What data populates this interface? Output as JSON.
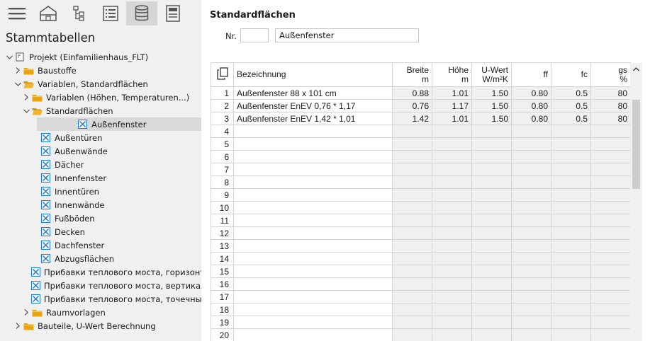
{
  "toolbar": {
    "buttons": [
      {
        "name": "menu-icon"
      },
      {
        "name": "building-icon"
      },
      {
        "name": "tree-structure-icon"
      },
      {
        "name": "list-icon"
      },
      {
        "name": "database-icon",
        "active": true
      },
      {
        "name": "calculator-icon"
      }
    ]
  },
  "left": {
    "title": "Stammtabellen",
    "tree": [
      {
        "label": "Projekt (Einfamilienhaus_FLT)",
        "level": 0,
        "expanded": true,
        "icon": "project-icon"
      },
      {
        "label": "Baustoffe",
        "level": 1,
        "expanded": false,
        "icon": "folder-icon"
      },
      {
        "label": "Variablen, Standardflächen",
        "level": 1,
        "expanded": true,
        "icon": "folder-open-icon"
      },
      {
        "label": "Variablen (Höhen, Temperaturen...)",
        "level": 2,
        "expanded": false,
        "icon": "folder-icon"
      },
      {
        "label": "Standardflächen",
        "level": 2,
        "expanded": true,
        "icon": "folder-open-icon"
      },
      {
        "label": "Außenfenster",
        "level": 3,
        "icon": "table-icon",
        "selected": true
      },
      {
        "label": "Außentüren",
        "level": 3,
        "icon": "table-icon"
      },
      {
        "label": "Außenwände",
        "level": 3,
        "icon": "table-icon"
      },
      {
        "label": "Dächer",
        "level": 3,
        "icon": "table-icon"
      },
      {
        "label": "Innenfenster",
        "level": 3,
        "icon": "table-icon"
      },
      {
        "label": "Innentüren",
        "level": 3,
        "icon": "table-icon"
      },
      {
        "label": "Innenwände",
        "level": 3,
        "icon": "table-icon"
      },
      {
        "label": "Fußböden",
        "level": 3,
        "icon": "table-icon"
      },
      {
        "label": "Decken",
        "level": 3,
        "icon": "table-icon"
      },
      {
        "label": "Dachfenster",
        "level": 3,
        "icon": "table-icon"
      },
      {
        "label": "Abzugsflächen",
        "level": 3,
        "icon": "table-icon"
      },
      {
        "label": "Прибавки теплового моста, горизонта",
        "level": 3,
        "icon": "table-icon"
      },
      {
        "label": "Прибавки теплового моста, вертикаль",
        "level": 3,
        "icon": "table-icon"
      },
      {
        "label": "Прибавки теплового моста, точечные",
        "level": 3,
        "icon": "table-icon"
      },
      {
        "label": "Raumvorlagen",
        "level": 2,
        "expanded": false,
        "icon": "folder-icon"
      },
      {
        "label": "Bauteile, U-Wert Berechnung",
        "level": 1,
        "expanded": false,
        "icon": "folder-icon"
      }
    ]
  },
  "main": {
    "title": "Standardflächen",
    "nr_label": "Nr.",
    "nr_value": "",
    "name_value": "Außenfenster",
    "columns": [
      {
        "l1": "",
        "l2": "",
        "kind": "icon"
      },
      {
        "l1": "Bezeichnung",
        "l2": "",
        "kind": "txt"
      },
      {
        "l1": "Breite",
        "l2": "m",
        "kind": "num"
      },
      {
        "l1": "Höhe",
        "l2": "m",
        "kind": "num"
      },
      {
        "l1": "U-Wert",
        "l2": "W/m²K",
        "kind": "num"
      },
      {
        "l1": "ff",
        "l2": "",
        "kind": "num"
      },
      {
        "l1": "fc",
        "l2": "",
        "kind": "num"
      },
      {
        "l1": "gs",
        "l2": "%",
        "kind": "num"
      }
    ],
    "rows": [
      {
        "n": "1",
        "name": "Außenfenster 88 x 101 cm",
        "breite": "0.88",
        "hoehe": "1.01",
        "uwert": "1.50",
        "ff": "0.80",
        "fc": "0.5",
        "gs": "80"
      },
      {
        "n": "2",
        "name": "Außenfenster EnEV 0,76 * 1,17",
        "breite": "0.76",
        "hoehe": "1.17",
        "uwert": "1.50",
        "ff": "0.80",
        "fc": "0.5",
        "gs": "80"
      },
      {
        "n": "3",
        "name": "Außenfenster EnEV 1,42 * 1,01",
        "breite": "1.42",
        "hoehe": "1.01",
        "uwert": "1.50",
        "ff": "0.80",
        "fc": "0.5",
        "gs": "80"
      },
      {
        "n": "4"
      },
      {
        "n": "5"
      },
      {
        "n": "6"
      },
      {
        "n": "7"
      },
      {
        "n": "8"
      },
      {
        "n": "9"
      },
      {
        "n": "10"
      },
      {
        "n": "11"
      },
      {
        "n": "12"
      },
      {
        "n": "13"
      },
      {
        "n": "14"
      },
      {
        "n": "15"
      },
      {
        "n": "16"
      },
      {
        "n": "17"
      },
      {
        "n": "18"
      },
      {
        "n": "19"
      },
      {
        "n": "20"
      }
    ]
  },
  "colors": {
    "sidebar_bg": "#f0f0f0",
    "selected_bg": "#d9d9d9",
    "folder": "#e8a50c",
    "table_icon": "#1f7bd0",
    "readonly_cell": "#f0f0f0"
  }
}
